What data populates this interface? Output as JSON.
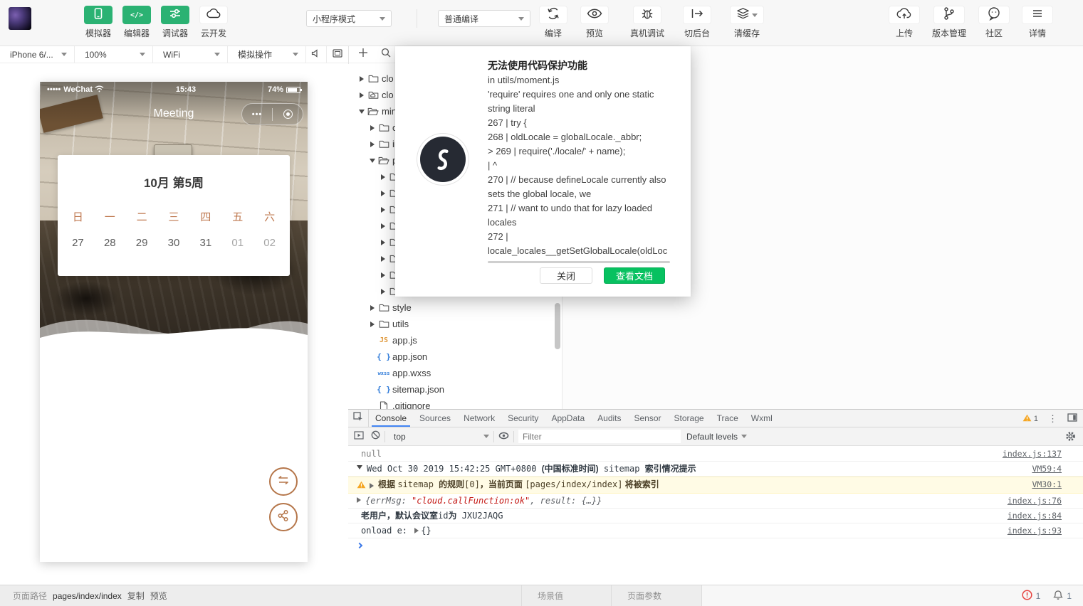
{
  "topbar": {
    "nav": [
      {
        "label": "模拟器",
        "icon": "phone-icon",
        "style": "green"
      },
      {
        "label": "编辑器",
        "icon": "code-icon",
        "style": "green"
      },
      {
        "label": "调试器",
        "icon": "sliders-icon",
        "style": "green"
      },
      {
        "label": "云开发",
        "icon": "cloud-icon",
        "style": "white"
      }
    ],
    "mode_select": "小程序模式",
    "compile_select": "普通编译",
    "actions": [
      {
        "label": "编译",
        "icon": "refresh-icon"
      },
      {
        "label": "预览",
        "icon": "eye-icon"
      },
      {
        "label": "真机调试",
        "icon": "bug-icon"
      },
      {
        "label": "切后台",
        "icon": "background-icon"
      },
      {
        "label": "清缓存",
        "icon": "layers-icon"
      }
    ],
    "right": [
      {
        "label": "上传",
        "icon": "upload-cloud-icon"
      },
      {
        "label": "版本管理",
        "icon": "branch-icon"
      },
      {
        "label": "社区",
        "icon": "chat-icon"
      },
      {
        "label": "详情",
        "icon": "menu-icon"
      }
    ]
  },
  "simbar": {
    "device": "iPhone 6/...",
    "zoom": "100%",
    "network": "WiFi",
    "action": "模拟操作"
  },
  "phone": {
    "status": {
      "signal": "•••••",
      "carrier": "WeChat",
      "time": "15:43",
      "battery": "74%"
    },
    "title": "Meeting",
    "capsule_dots": "•••",
    "calendar": {
      "title": "10月 第5周",
      "weekdays": [
        "日",
        "一",
        "二",
        "三",
        "四",
        "五",
        "六"
      ],
      "days": [
        {
          "d": "27",
          "muted": false
        },
        {
          "d": "28",
          "muted": false
        },
        {
          "d": "29",
          "muted": false
        },
        {
          "d": "30",
          "muted": false
        },
        {
          "d": "31",
          "muted": false
        },
        {
          "d": "01",
          "muted": true
        },
        {
          "d": "02",
          "muted": true
        }
      ]
    }
  },
  "tree": {
    "items": [
      {
        "level": 0,
        "arrow": "r",
        "icon": "folder",
        "label": "clo"
      },
      {
        "level": 0,
        "arrow": "r",
        "icon": "folder-cloud",
        "label": "clo"
      },
      {
        "level": 0,
        "arrow": "d",
        "icon": "folder-open",
        "label": "min"
      },
      {
        "level": 1,
        "arrow": "r",
        "icon": "folder",
        "label": "c"
      },
      {
        "level": 1,
        "arrow": "r",
        "icon": "folder",
        "label": "in"
      },
      {
        "level": 1,
        "arrow": "d",
        "icon": "folder-open",
        "label": "p"
      },
      {
        "level": 2,
        "arrow": "r",
        "icon": "folder",
        "label": ""
      },
      {
        "level": 2,
        "arrow": "r",
        "icon": "folder",
        "label": ""
      },
      {
        "level": 2,
        "arrow": "r",
        "icon": "folder",
        "label": ""
      },
      {
        "level": 2,
        "arrow": "r",
        "icon": "folder",
        "label": ""
      },
      {
        "level": 2,
        "arrow": "r",
        "icon": "folder",
        "label": ""
      },
      {
        "level": 2,
        "arrow": "r",
        "icon": "folder",
        "label": ""
      },
      {
        "level": 2,
        "arrow": "r",
        "icon": "folder",
        "label": ""
      },
      {
        "level": 2,
        "arrow": "r",
        "icon": "folder",
        "label": ""
      },
      {
        "level": 1,
        "arrow": "r",
        "icon": "folder",
        "label": "style"
      },
      {
        "level": 1,
        "arrow": "r",
        "icon": "folder",
        "label": "utils"
      },
      {
        "level": 1,
        "arrow": "",
        "icon": "js",
        "label": "app.js"
      },
      {
        "level": 1,
        "arrow": "",
        "icon": "json",
        "label": "app.json"
      },
      {
        "level": 1,
        "arrow": "",
        "icon": "wxss",
        "label": "app.wxss"
      },
      {
        "level": 1,
        "arrow": "",
        "icon": "json",
        "label": "sitemap.json"
      },
      {
        "level": 1,
        "arrow": "",
        "icon": "file",
        "label": ".gitignore"
      }
    ]
  },
  "dialog": {
    "title": "无法使用代码保护功能",
    "lines": [
      "in utils/moment.js",
      "'require' requires one and only one static",
      "string literal",
      "267 | try {",
      "268 | oldLocale = globalLocale._abbr;",
      "> 269 | require('./locale/' + name);",
      "| ^",
      "270 | // because defineLocale currently also",
      "sets the global locale, we",
      "271 | // want to undo that for lazy loaded",
      "locales",
      "272 |",
      "locale_locales__getSetGlobalLocale(oldLoc"
    ],
    "close_label": "关闭",
    "docs_label": "查看文档"
  },
  "devtools": {
    "tabs": [
      "Console",
      "Sources",
      "Network",
      "Security",
      "AppData",
      "Audits",
      "Sensor",
      "Storage",
      "Trace",
      "Wxml"
    ],
    "active_tab": "Console",
    "warn_badge": "1",
    "filter": {
      "context": "top",
      "placeholder": "Filter",
      "levels": "Default levels"
    },
    "messages": [
      {
        "kind": "log",
        "gut": "",
        "segs": [
          {
            "t": "null",
            "c": "val"
          }
        ],
        "link": "index.js:137"
      },
      {
        "kind": "log",
        "gut": "down",
        "segs": [
          {
            "t": "Wed Oct 30 2019 15:42:25 GMT+0800 ",
            "c": ""
          },
          {
            "t": "(中国标准时间)",
            "c": "cn"
          },
          {
            "t": " sitemap ",
            "c": ""
          },
          {
            "t": "索引情况提示",
            "c": "cn"
          }
        ],
        "link": "VM59:4"
      },
      {
        "kind": "warn",
        "gut": "warn,right",
        "segs": [
          {
            "t": "根据 ",
            "c": "cn"
          },
          {
            "t": "sitemap ",
            "c": ""
          },
          {
            "t": "的规则",
            "c": "cn"
          },
          {
            "t": "[0]",
            "c": ""
          },
          {
            "t": "，当前页面 ",
            "c": "cn"
          },
          {
            "t": "[pages/index/index]",
            "c": ""
          },
          {
            "t": " 将被索引",
            "c": "cn"
          }
        ],
        "link": "VM30:1"
      },
      {
        "kind": "log",
        "gut": "right",
        "segs": [
          {
            "t": "{errMsg: ",
            "c": "obj"
          },
          {
            "t": "\"cloud.callFunction:ok\"",
            "c": "str"
          },
          {
            "t": ", result: {…}}",
            "c": "obj"
          }
        ],
        "link": "index.js:76"
      },
      {
        "kind": "log",
        "gut": "",
        "segs": [
          {
            "t": "老用户，默认会议室",
            "c": "cn"
          },
          {
            "t": "id",
            "c": ""
          },
          {
            "t": "为",
            "c": "cn"
          },
          {
            "t": " JXU2JAQG",
            "c": ""
          }
        ],
        "link": "index.js:84"
      },
      {
        "kind": "log",
        "gut": "",
        "segs": [
          {
            "t": "onload e: ",
            "c": ""
          },
          {
            "t": "",
            "c": "caret"
          },
          {
            "t": "{}",
            "c": ""
          }
        ],
        "link": "index.js:93"
      }
    ]
  },
  "statusbar": {
    "path_label": "页面路径",
    "path": "pages/index/index",
    "copy": "复制",
    "preview": "预览",
    "scene": "场景值",
    "params": "页面参数",
    "error_count": "1",
    "bell_count": "1"
  }
}
